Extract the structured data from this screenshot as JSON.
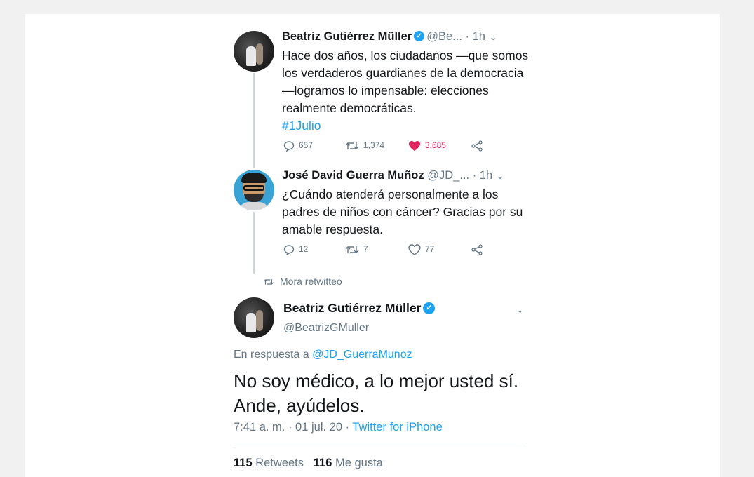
{
  "tweet1": {
    "name": "Beatriz Gutiérrez Müller",
    "handle": "@Be...",
    "time": "· 1h",
    "text": "Hace dos años, los ciudadanos —que somos los verdaderos guardianes de la democracia—logramos lo impensable: elecciones realmente democráticas.",
    "hashtag": "#1Julio",
    "replies": "657",
    "retweets": "1,374",
    "likes": "3,685",
    "liked": true
  },
  "tweet2": {
    "name": "José David Guerra Muñoz",
    "handle": "@JD_...",
    "time": "· 1h",
    "text": "¿Cuándo atenderá personalmente a los padres de niños con cáncer? Gracias por su amable respuesta.",
    "replies": "12",
    "retweets": "7",
    "likes": "77",
    "liked": false
  },
  "retweet_note": "Mora retwitteó",
  "main_tweet": {
    "name": "Beatriz Gutiérrez Müller",
    "handle": "@BeatrizGMuller",
    "reply_prefix": "En respuesta a",
    "reply_to": "@JD_GuerraMunoz",
    "text": "No soy médico, a lo mejor usted sí. Ande, ayúdelos.",
    "timestamp": "7:41 a. m. · 01 jul. 20 ·",
    "source": "Twitter for iPhone",
    "retweet_count": "115",
    "retweet_label": "Retweets",
    "like_count": "116",
    "like_label": "Me gusta"
  },
  "colors": {
    "accent": "#1da1f2",
    "like": "#e0245e",
    "secondary_text": "#657786"
  }
}
